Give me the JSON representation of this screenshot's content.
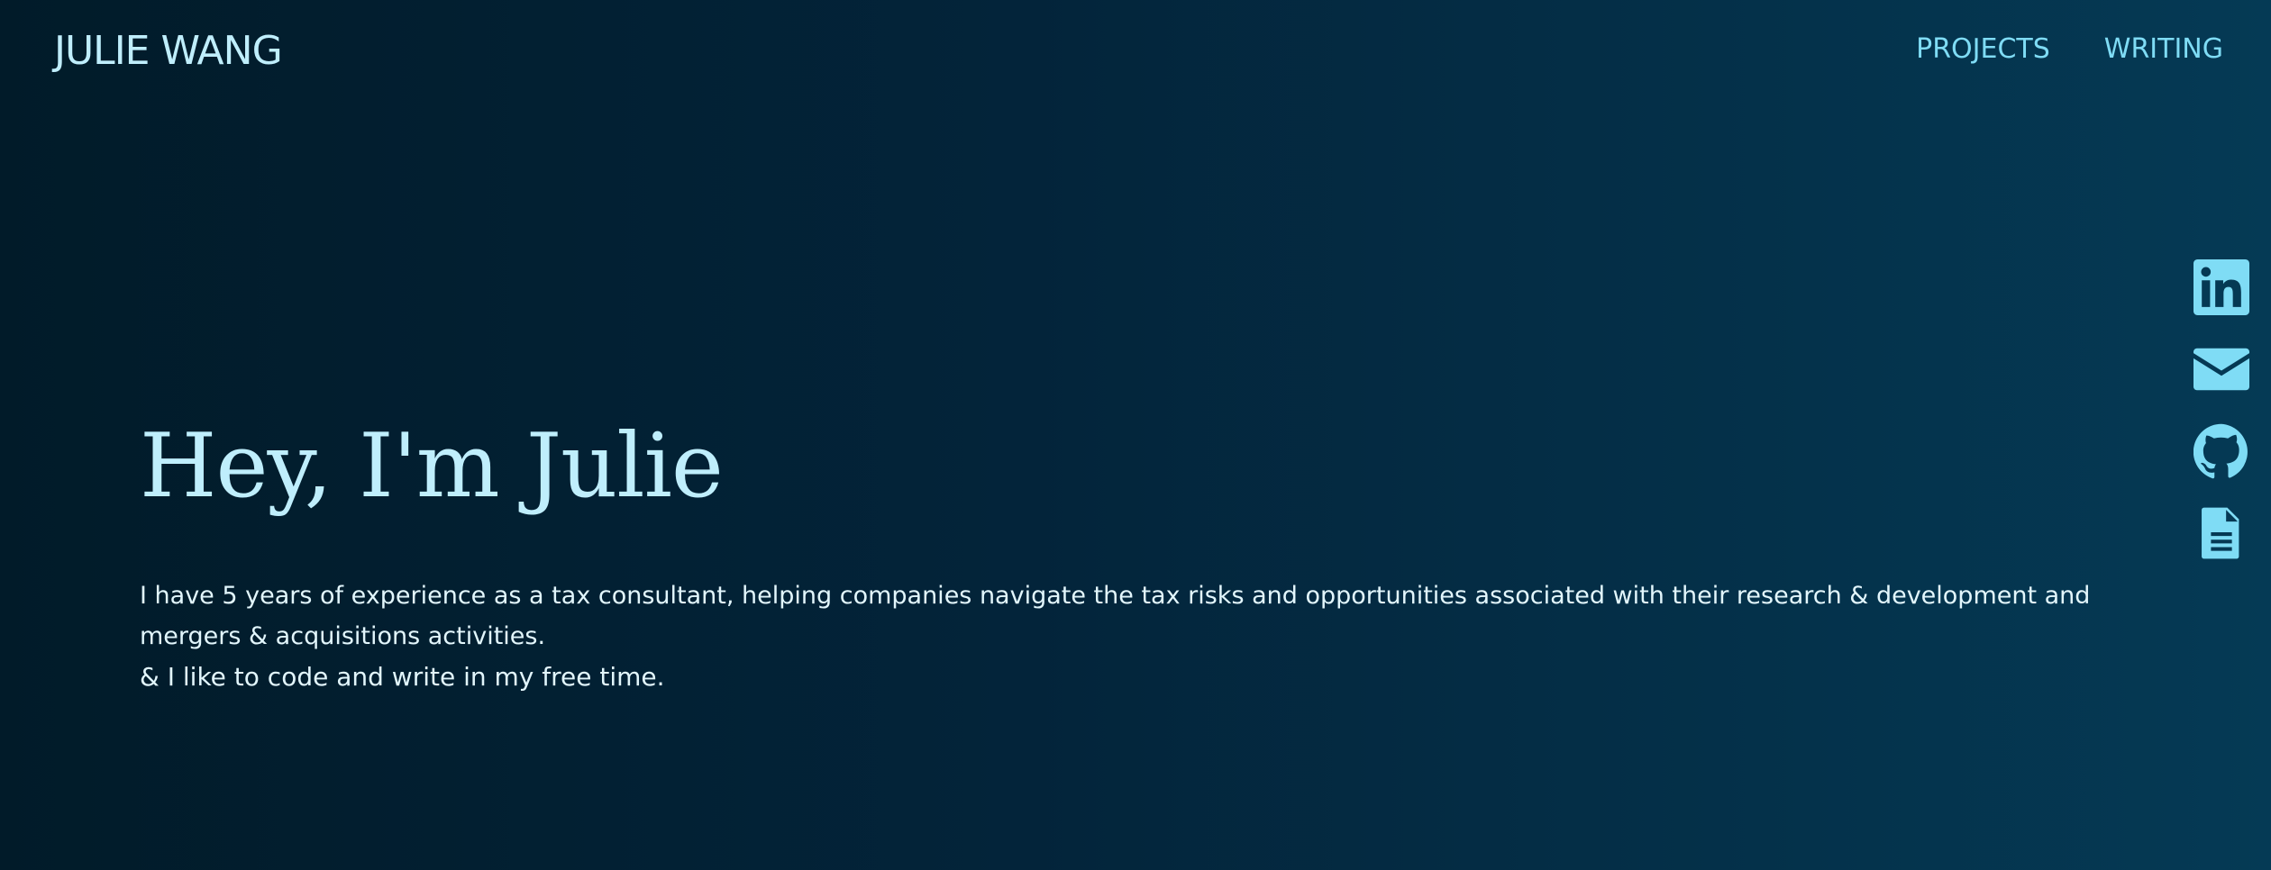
{
  "header": {
    "site_name": "JULIE WANG",
    "nav": [
      {
        "label": "PROJECTS"
      },
      {
        "label": "WRITING"
      }
    ]
  },
  "hero": {
    "heading": "Hey, I'm Julie",
    "paragraph_1": "I have 5 years of experience as a tax consultant, helping companies navigate the tax risks and opportunities associated with their research & development and mergers & acquisitions activities.",
    "paragraph_2": "& I like to code and write in my free time."
  },
  "social_icons": [
    "linkedin-icon",
    "email-icon",
    "github-icon",
    "resume-document-icon"
  ],
  "colors": {
    "background_start": "#011b29",
    "background_end": "#053a55",
    "accent": "#7fdcf5",
    "heading": "#bfeefc",
    "body_text": "#e2f6fc"
  }
}
